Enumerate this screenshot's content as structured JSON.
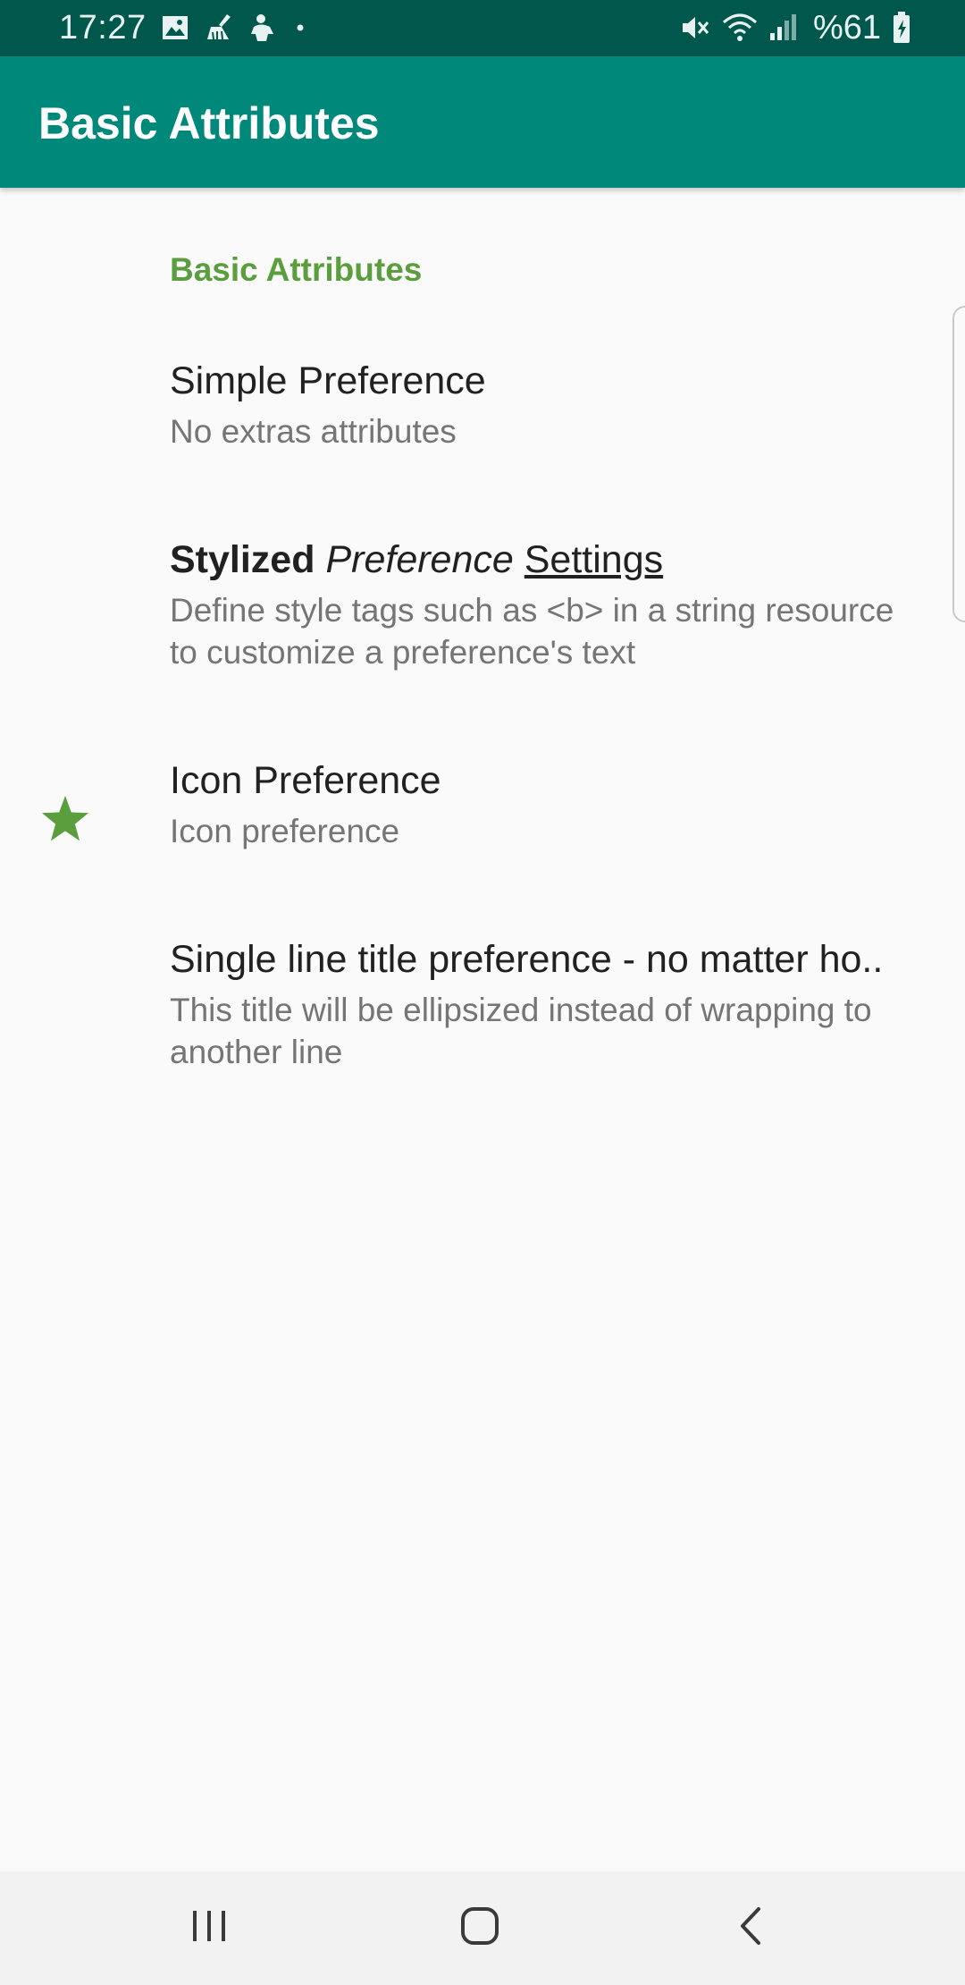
{
  "status_bar": {
    "time": "17:27",
    "left_icons": [
      "image-icon",
      "broom-icon",
      "hand-icon",
      "dot-icon"
    ],
    "right_icons": [
      "mute-icon",
      "wifi-icon",
      "signal-icon",
      "battery-icon"
    ],
    "battery_text": "%61"
  },
  "app_bar": {
    "title": "Basic Attributes",
    "color": "#00897b"
  },
  "category": {
    "title": "Basic Attributes",
    "color": "#5a9e3d"
  },
  "preferences": [
    {
      "title": "Simple Preference",
      "summary": "No extras attributes"
    },
    {
      "title_parts": {
        "bold": "Stylized",
        "italic": "Preference",
        "underline": "Settings"
      },
      "summary": "Define style tags such as <b> in a string resource to customize a preference's text"
    },
    {
      "icon": "star-icon",
      "title": "Icon Preference",
      "summary": "Icon preference"
    },
    {
      "title": "Single line title preference - no matter ho..",
      "summary": "This title will be ellipsized instead of wrapping to another line"
    }
  ],
  "nav_bar": {
    "buttons": [
      "recents-icon",
      "home-icon",
      "back-icon"
    ]
  }
}
